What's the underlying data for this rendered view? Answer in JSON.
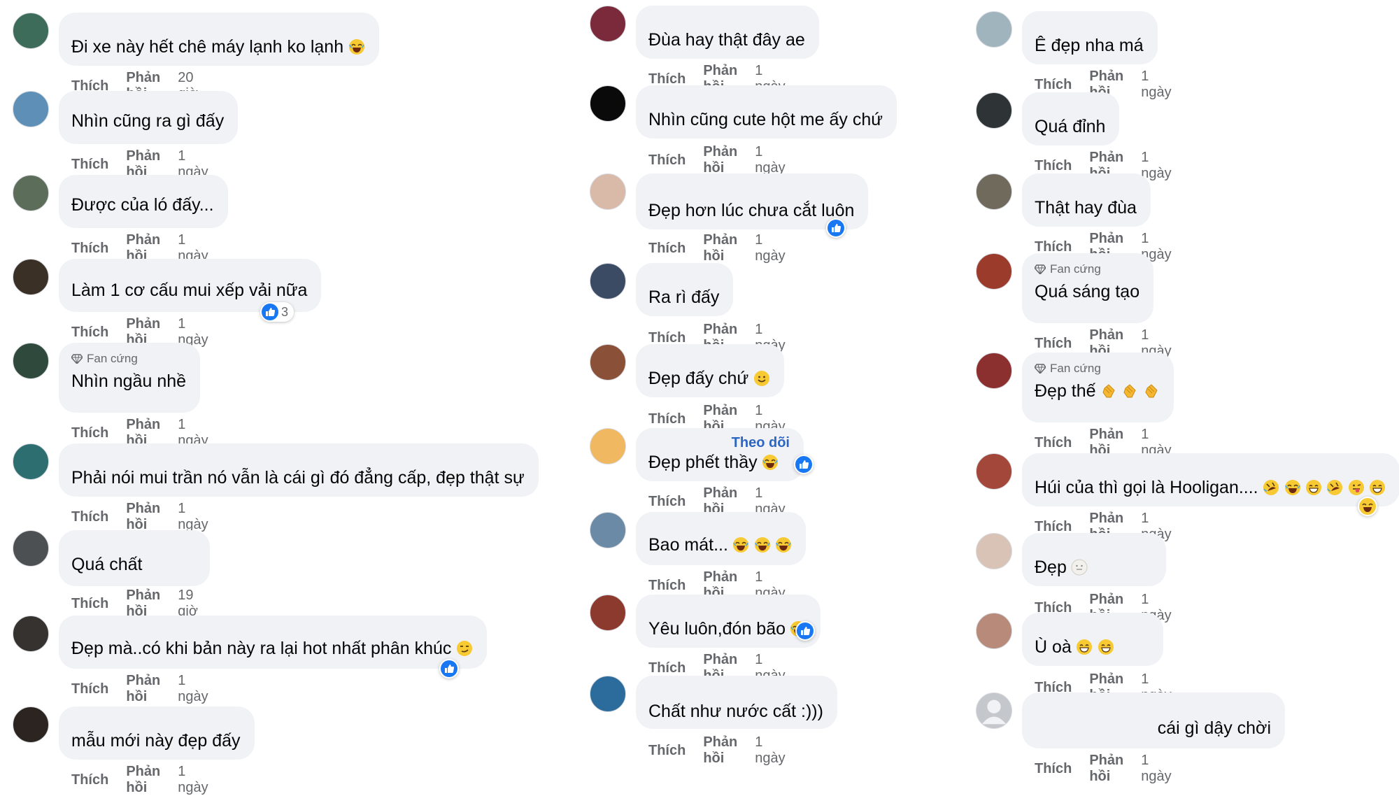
{
  "labels": {
    "like": "Thích",
    "reply": "Phản hồi",
    "fan": "Fan cứng",
    "follow": "Theo dõi"
  },
  "colors": {
    "bubble": "#f0f2f5",
    "meta": "#65676b",
    "link": "#2d65c2",
    "like": "#1877f2"
  },
  "columns": [
    {
      "comments": [
        {
          "avatar": "#3d6d5a",
          "text": "Đi xe này hết chê máy lạnh ko lạnh",
          "emojis": [
            "laughing-emoji"
          ],
          "time": "20 giờ"
        },
        {
          "avatar": "#5e8fb7",
          "text": "Nhìn cũng ra gì đấy",
          "emojis": [],
          "time": "1 ngày"
        },
        {
          "avatar": "#5c6e5a",
          "text": "Được của ló đấy...",
          "emojis": [],
          "time": "1 ngày"
        },
        {
          "avatar": "#3b3026",
          "text": "Làm 1 cơ cấu mui xếp vải nữa",
          "emojis": [],
          "time": "1 ngày",
          "reaction_count": "3"
        },
        {
          "avatar": "#2f4a3c",
          "fan": true,
          "text": "Nhìn ngầu nhề",
          "emojis": [],
          "time": "1 ngày"
        },
        {
          "avatar": "#2d6e70",
          "text": "Phải nói mui trần nó vẫn là cái gì đó đẳng cấp, đẹp thật sự",
          "emojis": [],
          "time": "1 ngày"
        },
        {
          "avatar": "#4d5052",
          "text": "Quá chất",
          "emojis": [],
          "time": "19 giờ"
        },
        {
          "avatar": "#36322f",
          "text": "Đẹp mà..có khi bản này ra lại hot nhất phân khúc",
          "emojis": [
            "smirk-emoji"
          ],
          "time": "1 ngày",
          "reaction_count": ""
        },
        {
          "avatar": "#2b2420",
          "text": "mẫu mới này đẹp đấy",
          "emojis": [],
          "time": "1 ngày"
        }
      ]
    },
    {
      "comments": [
        {
          "avatar": "#7a2a3a",
          "text": "Đùa hay thật đây ae",
          "emojis": [],
          "time": "1 ngày"
        },
        {
          "avatar": "#0a0a0a",
          "text": "Nhìn cũng cute hột me ấy chứ",
          "emojis": [],
          "time": "1 ngày"
        },
        {
          "avatar": "#d9b9a8",
          "text": "Đẹp hơn lúc chưa cắt luôn",
          "emojis": [],
          "time": "1 ngày",
          "reaction_count": ""
        },
        {
          "avatar": "#3a4b63",
          "text": "Ra rì đấy",
          "emojis": [],
          "time": "1 ngày"
        },
        {
          "avatar": "#8a5038",
          "text": "Đẹp đấy chứ",
          "emojis": [
            "smile-emoji"
          ],
          "time": "1 ngày"
        },
        {
          "avatar": "#f0b860",
          "follow": true,
          "text": "Đẹp phết thầy",
          "emojis": [
            "laughing-emoji"
          ],
          "time": "1 ngày",
          "reaction_count": ""
        },
        {
          "avatar": "#6b8aa6",
          "text": "Bao mát...",
          "emojis": [
            "laughing-emoji",
            "laughing-emoji",
            "laughing-emoji"
          ],
          "time": "1 ngày"
        },
        {
          "avatar": "#8c3a2e",
          "text": "Yêu luôn,đón bão",
          "emojis": [
            "laughing-emoji"
          ],
          "time": "1 ngày",
          "reaction_count": ""
        },
        {
          "avatar": "#2c6c9c",
          "text": "Chất như nước cất :)))",
          "emojis": [],
          "time": "1 ngày"
        }
      ]
    },
    {
      "comments": [
        {
          "avatar": "#9fb4bd",
          "text": "Ê đẹp nha má",
          "emojis": [],
          "time": "1 ngày"
        },
        {
          "avatar": "#2e3436",
          "text": "Quá đỉnh",
          "emojis": [],
          "time": "1 ngày"
        },
        {
          "avatar": "#6f6a5c",
          "text": "Thật hay đùa",
          "emojis": [],
          "time": "1 ngày"
        },
        {
          "avatar": "#9a3b2b",
          "fan": true,
          "text": "Quá sáng tạo",
          "emojis": [],
          "time": "1 ngày"
        },
        {
          "avatar": "#8b2f2f",
          "fan": true,
          "text": "Đẹp thế",
          "emojis": [
            "clap-emoji",
            "clap-emoji",
            "clap-emoji"
          ],
          "time": "1 ngày"
        },
        {
          "avatar": "#a3473a",
          "text": "Húi của thì gọi là Hooligan....",
          "emojis": [
            "rofl-emoji",
            "laughing-emoji",
            "grin-emoji",
            "rofl-emoji",
            "tongue-emoji",
            "grin-emoji"
          ],
          "time": "1 ngày",
          "reaction_count": ""
        },
        {
          "avatar": "#d8c3b6",
          "text": "Đẹp",
          "emojis": [
            "neutral-emoji"
          ],
          "time": "1 ngày"
        },
        {
          "avatar": "#b88a7a",
          "text": "Ù oà",
          "emojis": [
            "grin-emoji",
            "grin-emoji"
          ],
          "time": "1 ngày"
        },
        {
          "avatar": "#c4c7cc",
          "text": "cái gì dậy chời",
          "emojis": [],
          "time": "1 ngày"
        }
      ]
    }
  ]
}
